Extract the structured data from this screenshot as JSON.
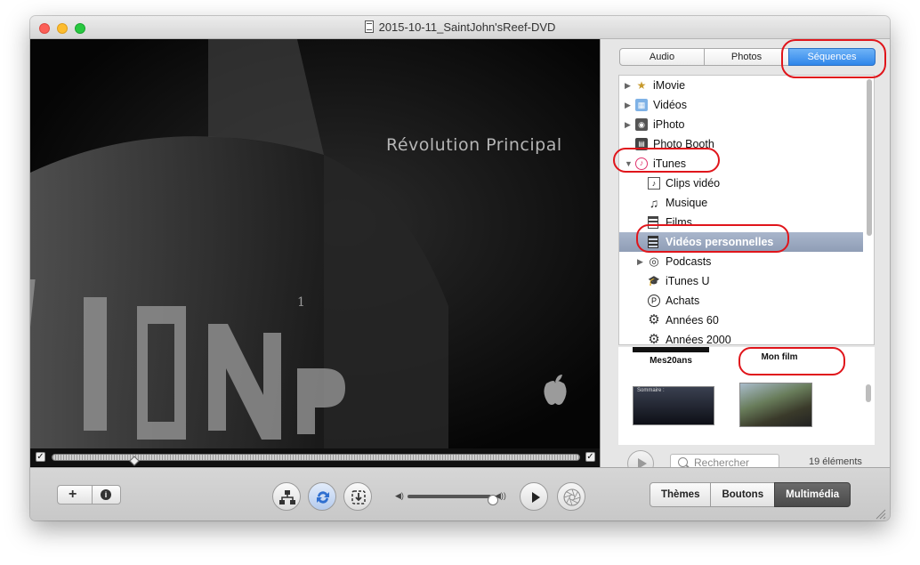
{
  "window": {
    "title": "2015-10-11_SaintJohn'sReef-DVD"
  },
  "preview": {
    "menu_text": "Révolution Principal"
  },
  "media_tabs": [
    "Audio",
    "Photos",
    "Séquences"
  ],
  "sources": [
    {
      "label": "iMovie",
      "icon": "imovie-icon",
      "indent": 0,
      "arrow": "right"
    },
    {
      "label": "Vidéos",
      "icon": "videos-folder-icon",
      "indent": 0,
      "arrow": "right"
    },
    {
      "label": "iPhoto",
      "icon": "iphoto-icon",
      "indent": 0,
      "arrow": "right"
    },
    {
      "label": "Photo Booth",
      "icon": "photo-booth-icon",
      "indent": 0,
      "arrow": ""
    },
    {
      "label": "iTunes",
      "icon": "itunes-icon",
      "indent": 0,
      "arrow": "down"
    },
    {
      "label": "Clips vidéo",
      "icon": "music-video-icon",
      "indent": 1,
      "arrow": ""
    },
    {
      "label": "Musique",
      "icon": "music-note-icon",
      "indent": 1,
      "arrow": ""
    },
    {
      "label": "Films",
      "icon": "film-icon",
      "indent": 1,
      "arrow": ""
    },
    {
      "label": "Vidéos personnelles",
      "icon": "home-video-icon",
      "indent": 1,
      "arrow": "",
      "selected": true
    },
    {
      "label": "Podcasts",
      "icon": "podcast-icon",
      "indent": 1,
      "arrow": "right"
    },
    {
      "label": "iTunes U",
      "icon": "itunes-u-icon",
      "indent": 1,
      "arrow": ""
    },
    {
      "label": "Achats",
      "icon": "purchases-icon",
      "indent": 1,
      "arrow": ""
    },
    {
      "label": "Années 60",
      "icon": "gear-icon",
      "indent": 1,
      "arrow": ""
    },
    {
      "label": "Années 2000",
      "icon": "gear-icon",
      "indent": 1,
      "arrow": ""
    }
  ],
  "thumbnails": {
    "row1": [
      "Mes20ans",
      "Mon film"
    ],
    "row2_caption": "Sommaire :"
  },
  "search": {
    "placeholder": "Rechercher"
  },
  "item_count": "19 éléments",
  "modes": [
    "Thèmes",
    "Boutons",
    "Multimédia"
  ],
  "colors": {
    "selection": "#9aa7be",
    "accent_blue": "#2f86ea",
    "annotation_red": "#e0151b"
  }
}
